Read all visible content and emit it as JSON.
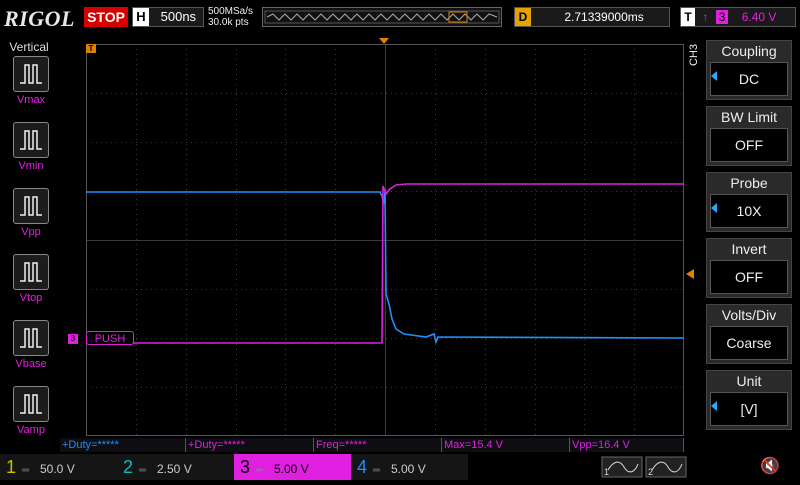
{
  "header": {
    "logo": "RIGOL",
    "run_state": "STOP",
    "timebase_label": "H",
    "timebase_value": "500ns",
    "sample_rate": "500MSa/s",
    "points": "30.0k pts",
    "delay_label": "D",
    "delay_value": "2.71339000ms",
    "trigger_label": "T",
    "trigger_channel": "3",
    "trigger_level": "6.40 V"
  },
  "left_panel": {
    "title": "Vertical",
    "items": [
      {
        "label": "Vmax",
        "icon": "vmax-icon"
      },
      {
        "label": "Vmin",
        "icon": "vmin-icon"
      },
      {
        "label": "Vpp",
        "icon": "vpp-icon"
      },
      {
        "label": "Vtop",
        "icon": "vtop-icon"
      },
      {
        "label": "Vbase",
        "icon": "vbase-icon"
      },
      {
        "label": "Vamp",
        "icon": "vamp-icon"
      }
    ]
  },
  "channel_label": "PUSH",
  "right_menu": {
    "channel_tag": "CH3",
    "items": [
      {
        "title": "Coupling",
        "value": "DC",
        "has_arrow": true
      },
      {
        "title": "BW Limit",
        "value": "OFF",
        "has_arrow": false
      },
      {
        "title": "Probe",
        "value": "10X",
        "has_arrow": true
      },
      {
        "title": "Invert",
        "value": "OFF",
        "has_arrow": false
      },
      {
        "title": "Volts/Div",
        "value": "Coarse",
        "has_arrow": false
      },
      {
        "title": "Unit",
        "value": "[V]",
        "has_arrow": true
      }
    ]
  },
  "measurements": [
    {
      "text": "+Duty=*****",
      "color": "blue"
    },
    {
      "text": "+Duty=*****",
      "color": "magenta"
    },
    {
      "text": "Freq=*****",
      "color": "magenta"
    },
    {
      "text": "Max=15.4 V",
      "color": "magenta"
    },
    {
      "text": "Vpp=16.4 V",
      "color": "magenta"
    }
  ],
  "channels": [
    {
      "num": "1",
      "scale": "50.0 V",
      "color": "#c8c000",
      "active": false
    },
    {
      "num": "2",
      "scale": "2.50 V",
      "color": "#00c0c0",
      "active": false
    },
    {
      "num": "3",
      "scale": "5.00 V",
      "color": "#e020e0",
      "active": true
    },
    {
      "num": "4",
      "scale": "5.00 V",
      "color": "#1e90ff",
      "active": false
    }
  ],
  "colors": {
    "ch3": "#e020e0",
    "ch4": "#1e90ff",
    "trigger": "#e08000",
    "grid": "#3a3a3a"
  }
}
